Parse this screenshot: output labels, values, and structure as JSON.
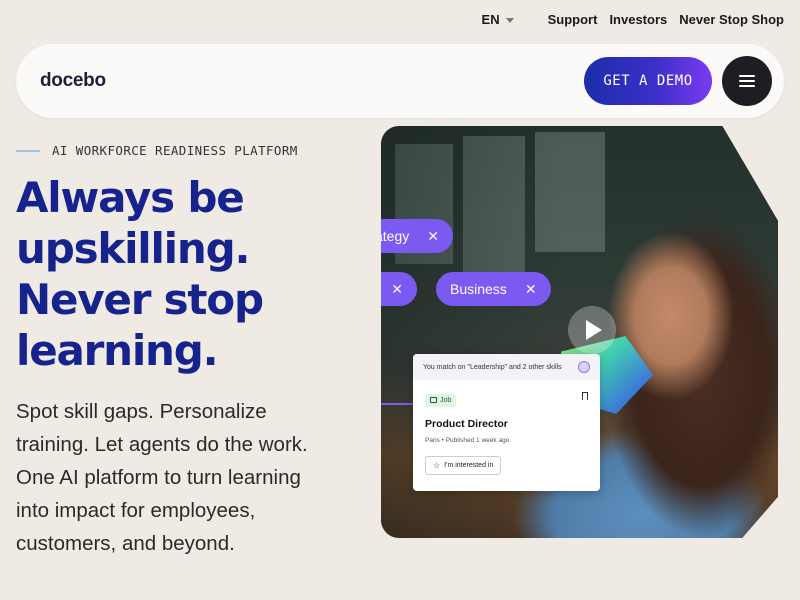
{
  "util_nav": {
    "language": "EN",
    "links": [
      "Support",
      "Investors",
      "Never Stop Shop"
    ]
  },
  "header": {
    "logo": "docebo",
    "cta": "GET A DEMO",
    "menu_icon": "hamburger-icon"
  },
  "hero": {
    "eyebrow": "AI WORKFORCE READINESS PLATFORM",
    "headline": [
      "Always be",
      "upskilling.",
      "Never stop",
      "learning."
    ],
    "body": "Spot skill gaps. Personalize training. Let agents do the work. One AI platform to turn learning into impact for employees, customers, and beyond."
  },
  "media": {
    "chips": [
      {
        "label": "ategy",
        "close": "✕"
      },
      {
        "label": "",
        "close": "✕"
      },
      {
        "label": "Business",
        "close": "✕"
      }
    ],
    "play_icon": "play-icon",
    "job_card": {
      "match_text": "You match on \"Leadership\" and 2 other skills",
      "tag": "Job",
      "title": "Product Director",
      "meta": "Paris • Published 1 week ago",
      "button": "I'm interested in"
    }
  },
  "colors": {
    "background": "#efebe4",
    "headline": "#16238c",
    "cta_gradient_start": "#1b2ea8",
    "cta_gradient_end": "#7b3bf0",
    "chip": "#7a5af0"
  }
}
